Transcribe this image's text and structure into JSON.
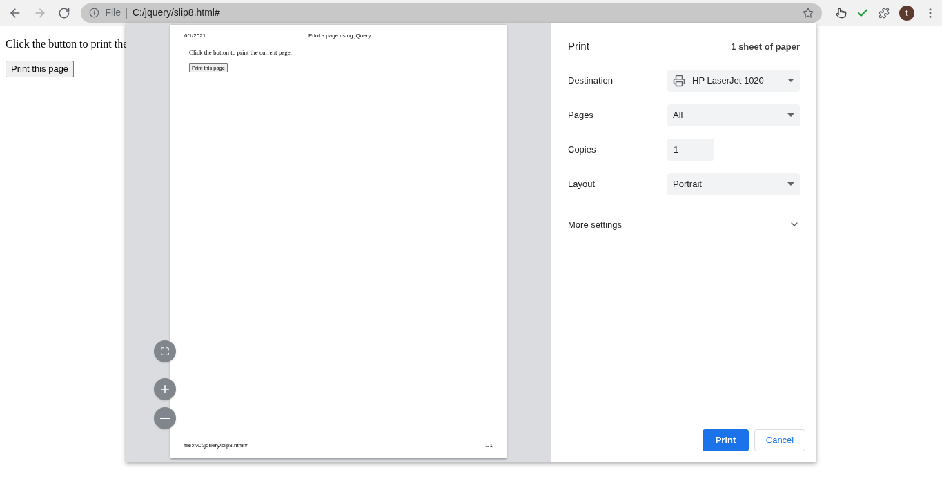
{
  "browser": {
    "address_scheme": "File",
    "address": "C:/jquery/slip8.html#",
    "avatar_letter": "t"
  },
  "page": {
    "text": "Click the button to print the",
    "button": "Print this page"
  },
  "preview": {
    "header_left": "6/1/2021",
    "header_center": "Print a page using jQuery",
    "body_text": "Click the button to print the current page.",
    "body_button": "Print this page",
    "footer_left": "file:///C:/jquery/slip8.html#",
    "footer_right": "1/1"
  },
  "print_dialog": {
    "title": "Print",
    "sheets": "1 sheet of paper",
    "settings": [
      {
        "label": "Destination",
        "value": "HP LaserJet 1020",
        "kind": "device"
      },
      {
        "label": "Pages",
        "value": "All",
        "kind": "select"
      },
      {
        "label": "Copies",
        "value": "1",
        "kind": "number"
      },
      {
        "label": "Layout",
        "value": "Portrait",
        "kind": "select"
      }
    ],
    "more_settings": {
      "label": "More settings",
      "expanded": false
    },
    "buttons": [
      {
        "label": "Print",
        "primary": true
      },
      {
        "label": "Cancel",
        "primary": false
      }
    ]
  }
}
